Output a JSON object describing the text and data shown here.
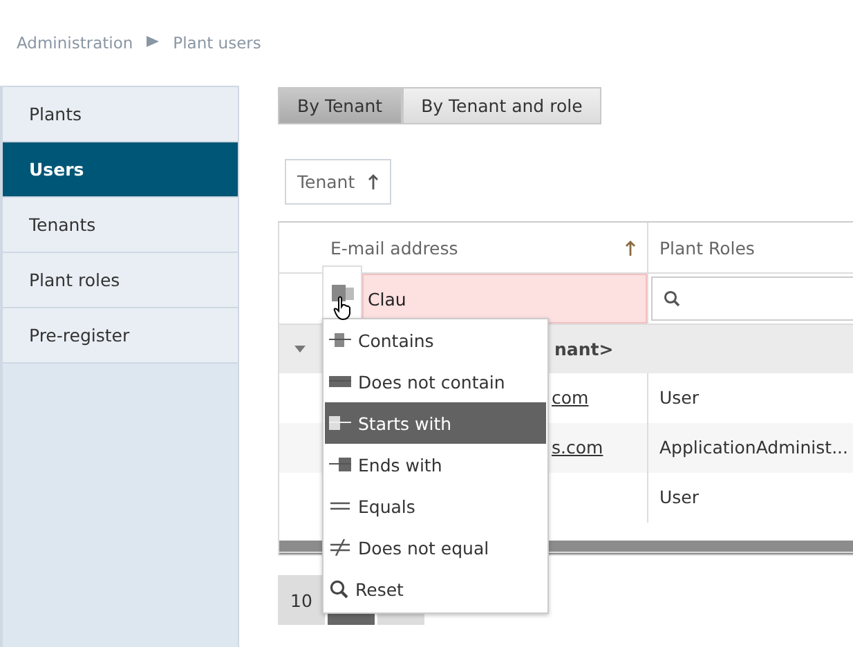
{
  "breadcrumb": [
    "Administration",
    "Plant users"
  ],
  "sidebar": {
    "items": [
      {
        "label": "Plants",
        "selected": false
      },
      {
        "label": "Users",
        "selected": true
      },
      {
        "label": "Tenants",
        "selected": false
      },
      {
        "label": "Plant roles",
        "selected": false
      },
      {
        "label": "Pre-register",
        "selected": false
      }
    ]
  },
  "tabs": [
    {
      "label": "By Tenant",
      "selected": true
    },
    {
      "label": "By Tenant and role",
      "selected": false
    }
  ],
  "group_chip": {
    "label": "Tenant"
  },
  "table": {
    "columns": [
      {
        "label": "E-mail address",
        "sorted": true
      },
      {
        "label": "Plant Roles",
        "sorted": false
      }
    ],
    "filter": {
      "value": "Clau"
    },
    "group_row": {
      "label": "nant>",
      "expanded": true
    },
    "rows": [
      {
        "email": "com",
        "role": "User"
      },
      {
        "email": "s.com",
        "role": "ApplicationAdminist..."
      },
      {
        "email": "",
        "role": "User"
      }
    ]
  },
  "pager": {
    "page_size": "10"
  },
  "filter_menu": {
    "items": [
      {
        "kind": "contains",
        "label": "Contains",
        "selected": false
      },
      {
        "kind": "notcontains",
        "label": "Does not contain",
        "selected": false
      },
      {
        "kind": "starts",
        "label": "Starts with",
        "selected": true
      },
      {
        "kind": "ends",
        "label": "Ends with",
        "selected": false
      },
      {
        "kind": "equals",
        "label": "Equals",
        "selected": false
      },
      {
        "kind": "notequals",
        "label": "Does not equal",
        "selected": false
      },
      {
        "kind": "reset",
        "label": "Reset",
        "selected": false
      }
    ]
  }
}
